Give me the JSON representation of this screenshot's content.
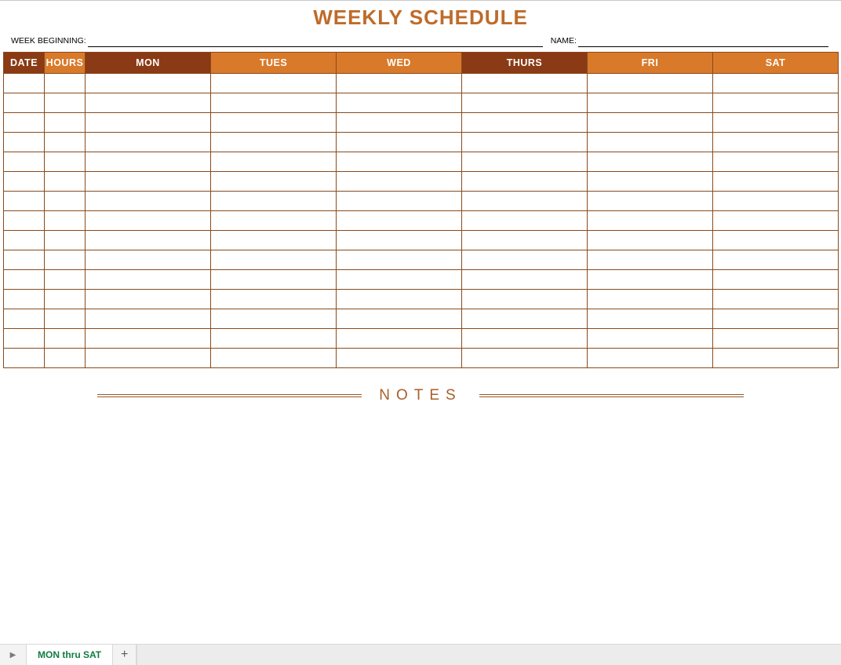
{
  "title": "WEEKLY SCHEDULE",
  "header": {
    "week_label": "WEEK BEGINNING:",
    "week_value": "",
    "name_label": "NAME:",
    "name_value": ""
  },
  "columns": [
    {
      "label": "DATE",
      "cls": "brown",
      "width": "col-date"
    },
    {
      "label": "HOURS",
      "cls": "orange",
      "width": "col-hours"
    },
    {
      "label": "MON",
      "cls": "brown",
      "width": "col-day"
    },
    {
      "label": "TUES",
      "cls": "orange",
      "width": "col-day"
    },
    {
      "label": "WED",
      "cls": "orange",
      "width": "col-day"
    },
    {
      "label": "THURS",
      "cls": "brown",
      "width": "col-day"
    },
    {
      "label": "FRI",
      "cls": "orange",
      "width": "col-day"
    },
    {
      "label": "SAT",
      "cls": "orange",
      "width": "col-day"
    }
  ],
  "row_count": 15,
  "notes_label": "NOTES",
  "tabbar": {
    "active_tab": "MON thru SAT",
    "add_symbol": "+",
    "nav_symbol": "▶"
  },
  "colors": {
    "brown": "#8a3a14",
    "orange": "#d97a2a",
    "title": "#bf6b2a",
    "notes": "#a95e2a"
  }
}
